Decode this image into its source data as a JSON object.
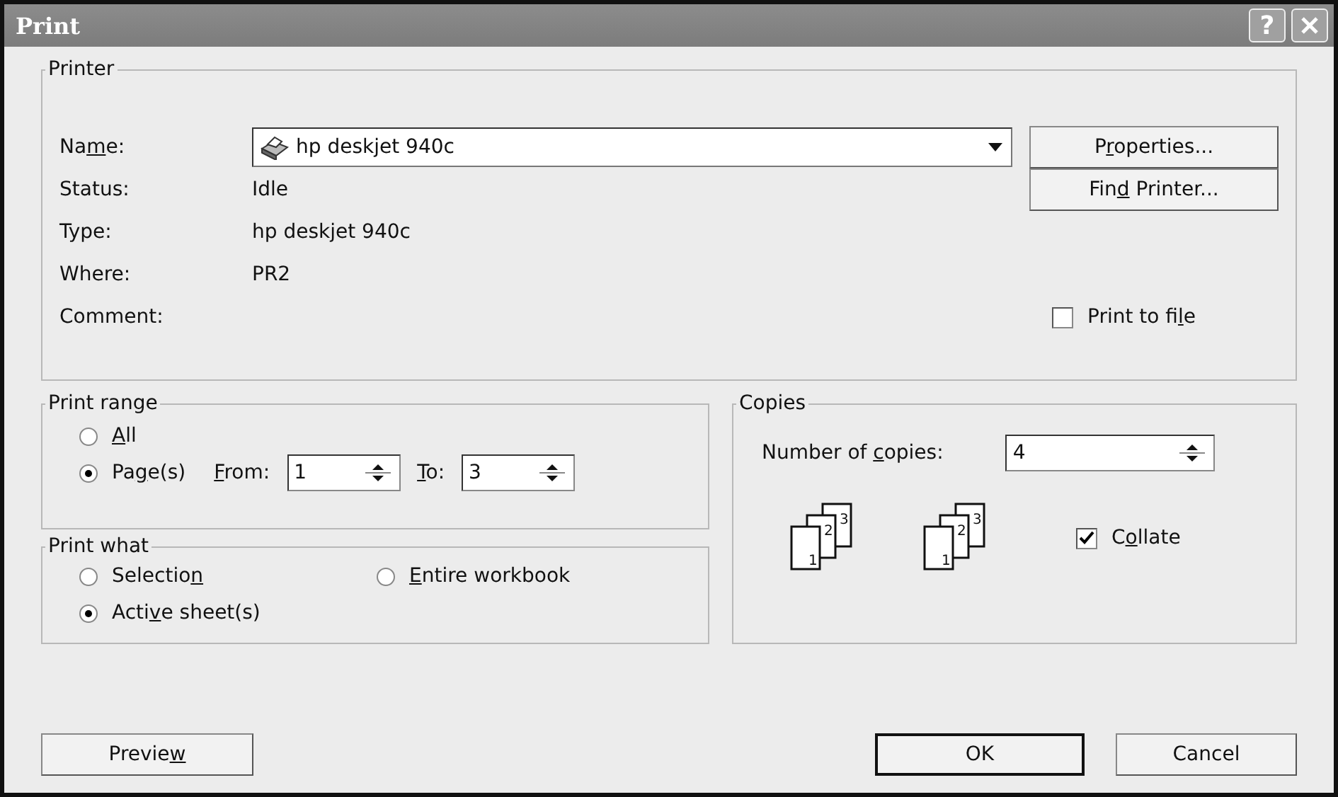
{
  "window": {
    "title": "Print",
    "help_button": "?"
  },
  "printer": {
    "legend": "Printer",
    "name_label": {
      "before": "Na",
      "key": "m",
      "after": "e:"
    },
    "name_value": "hp deskjet 940c",
    "status_label": "Status:",
    "status": "Idle",
    "type_label": "Type:",
    "type": "hp deskjet 940c",
    "where_label": "Where:",
    "where": "PR2",
    "comment_label": "Comment:",
    "properties_button": {
      "before": "P",
      "key": "r",
      "after": "operties..."
    },
    "find_button": {
      "before": "Fin",
      "key": "d",
      "after": " Printer..."
    },
    "print_to_file": {
      "label": {
        "before": "Print to fi",
        "key": "l",
        "after": "e"
      },
      "checked": false
    }
  },
  "print_range": {
    "legend": "Print range",
    "options": [
      {
        "label": {
          "key": "A",
          "after": "ll"
        },
        "selected": false
      },
      {
        "label": {
          "before": "Pa",
          "key": "g",
          "after": "e(s)"
        },
        "selected": true
      }
    ],
    "from_label": {
      "key": "F",
      "after": "rom:"
    },
    "from": "1",
    "to_label": {
      "key": "T",
      "after": "o:"
    },
    "to": "3"
  },
  "print_what": {
    "legend": "Print what",
    "options": [
      {
        "label": {
          "before": "Selectio",
          "key": "n"
        },
        "selected": false
      },
      {
        "label": {
          "key": "E",
          "after": "ntire workbook"
        },
        "selected": false
      },
      {
        "label": {
          "before": "Acti",
          "key": "v",
          "after": "e sheet(s)"
        },
        "selected": true
      }
    ]
  },
  "copies": {
    "legend": "Copies",
    "count_label": {
      "before": "Number of ",
      "key": "c",
      "after": "opies:"
    },
    "count": "4",
    "collate_pages": [
      [
        "1",
        "2",
        "3"
      ],
      [
        "1",
        "2",
        "3"
      ]
    ],
    "collate": {
      "label": {
        "before": "C",
        "key": "o",
        "after": "llate"
      },
      "checked": true
    }
  },
  "buttons": {
    "preview": {
      "before": "Previe",
      "key": "w"
    },
    "ok": "OK",
    "cancel": "Cancel"
  }
}
